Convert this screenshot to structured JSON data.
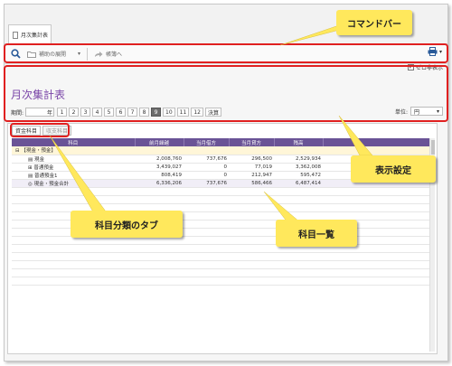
{
  "tab_title": "月次集計表",
  "command_bar": {
    "expand_label": "補助の展開",
    "next_label": "帳簿へ"
  },
  "settings": {
    "zero_label": "ゼロ非表示",
    "zero_checked": true,
    "report_title": "月次集計表",
    "period_label": "期間:",
    "year_suffix": "年",
    "months": [
      "1",
      "2",
      "3",
      "4",
      "5",
      "6",
      "7",
      "8",
      "9",
      "10",
      "11",
      "12",
      "決算"
    ],
    "selected_month": "9",
    "unit_label": "単位:",
    "unit_value": "円"
  },
  "subtabs": [
    "資金科目",
    "収支科目"
  ],
  "table": {
    "headers": [
      "科目",
      "前月繰越",
      "当月借方",
      "当月貸方",
      "残高"
    ],
    "rows": [
      {
        "name": "【現金・預金】",
        "values": [
          "",
          "",
          "",
          ""
        ],
        "kind": "category"
      },
      {
        "name": "現金",
        "values": [
          "2,008,760",
          "737,676",
          "296,500",
          "2,529,934"
        ],
        "kind": "item"
      },
      {
        "name": "普通預金",
        "values": [
          "3,439,027",
          "0",
          "77,019",
          "3,362,008"
        ],
        "kind": "item"
      },
      {
        "name": "普通預金1",
        "values": [
          "808,419",
          "0",
          "212,947",
          "595,472"
        ],
        "kind": "item"
      },
      {
        "name": "現金・預金合計",
        "values": [
          "6,336,206",
          "737,676",
          "586,466",
          "6,487,414"
        ],
        "kind": "total"
      }
    ]
  },
  "annotations": {
    "command_bar": "コマンドバー",
    "settings": "表示設定",
    "category_tabs": "科目分類のタブ",
    "account_list": "科目一覧"
  },
  "colors": {
    "accent_purple": "#6a5396",
    "highlight_red": "#e02020",
    "callout_yellow": "#ffe85c"
  }
}
